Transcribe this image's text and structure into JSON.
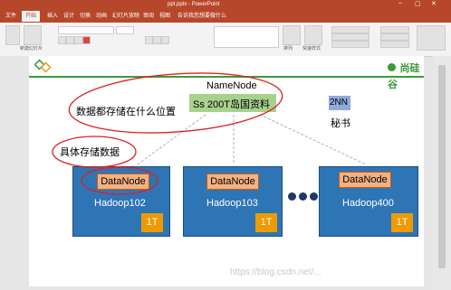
{
  "window": {
    "title": "ppt.pptx - PowerPoint"
  },
  "ribbon_tabs": [
    "文件",
    "开始",
    "插入",
    "设计",
    "切换",
    "动画",
    "幻灯片放映",
    "审阅",
    "视图",
    "告诉我您想要做什么"
  ],
  "ribbon": {
    "new_slide": "新建幻灯片",
    "arrange": "排列",
    "quick_styles": "快速样式"
  },
  "slide": {
    "brand": "尚硅谷",
    "namenode": "NameNode",
    "metadata_box": "Ss 200T岛国资料",
    "secondary": "2NN",
    "secretary": "秘书",
    "annot_where": "数据都存储在什么位置",
    "annot_data": "具体存储数据",
    "nodes": [
      {
        "label": "DataNode",
        "host": "Hadoop102",
        "cap": "1T"
      },
      {
        "label": "DataNode",
        "host": "Hadoop103",
        "cap": "1T"
      },
      {
        "label": "DataNode",
        "host": "Hadoop400",
        "cap": "1T"
      }
    ],
    "watermark": "https://blog.csdn.net/..."
  },
  "colors": {
    "ppt_red": "#b7472a",
    "node_blue": "#2e75b6",
    "node_orange": "#f4b183",
    "cap_orange": "#ed9b00",
    "name_green": "#a9d18e",
    "nn2": "#8faadc",
    "annot_red": "#e02020",
    "brand_green": "#3a9a3a"
  }
}
